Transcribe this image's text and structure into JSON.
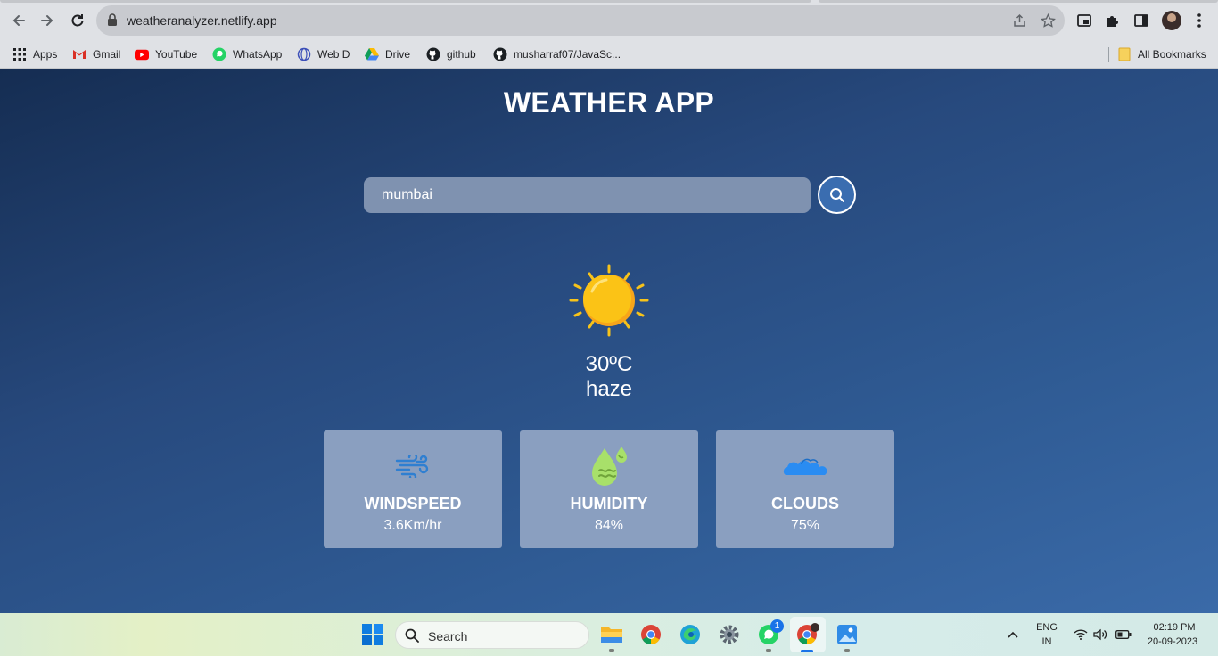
{
  "browser": {
    "url": "weatheranalyzer.netlify.app",
    "bookmarks": [
      {
        "label": "Apps",
        "icon": "apps-grid-icon"
      },
      {
        "label": "Gmail",
        "icon": "gmail-icon"
      },
      {
        "label": "YouTube",
        "icon": "youtube-icon"
      },
      {
        "label": "WhatsApp",
        "icon": "whatsapp-icon"
      },
      {
        "label": "Web D",
        "icon": "webd-icon"
      },
      {
        "label": "Drive",
        "icon": "drive-icon"
      },
      {
        "label": "github",
        "icon": "github-icon"
      },
      {
        "label": "musharraf07/JavaSc...",
        "icon": "github-icon"
      }
    ],
    "all_bookmarks_label": "All Bookmarks"
  },
  "app": {
    "title": "WEATHER APP",
    "search": {
      "value": "mumbai"
    },
    "weather": {
      "temperature": "30ºC",
      "condition": "haze",
      "icon": "sun-icon"
    },
    "cards": [
      {
        "title": "WINDSPEED",
        "value": "3.6Km/hr",
        "icon": "wind-icon",
        "color": "#2f7fd1"
      },
      {
        "title": "HUMIDITY",
        "value": "84%",
        "icon": "humidity-icon",
        "color": "#a8e06a"
      },
      {
        "title": "CLOUDS",
        "value": "75%",
        "icon": "clouds-icon",
        "color": "#2a8cf2"
      }
    ]
  },
  "taskbar": {
    "search_label": "Search",
    "whatsapp_badge": "1",
    "language": "ENG",
    "region": "IN",
    "time": "02:19 PM",
    "date": "20-09-2023"
  },
  "colors": {
    "page_gradient_start": "#152d52",
    "page_gradient_end": "#3a6aa8",
    "card_bg": "#8a9fc0",
    "search_bg": "#7f92b0"
  }
}
